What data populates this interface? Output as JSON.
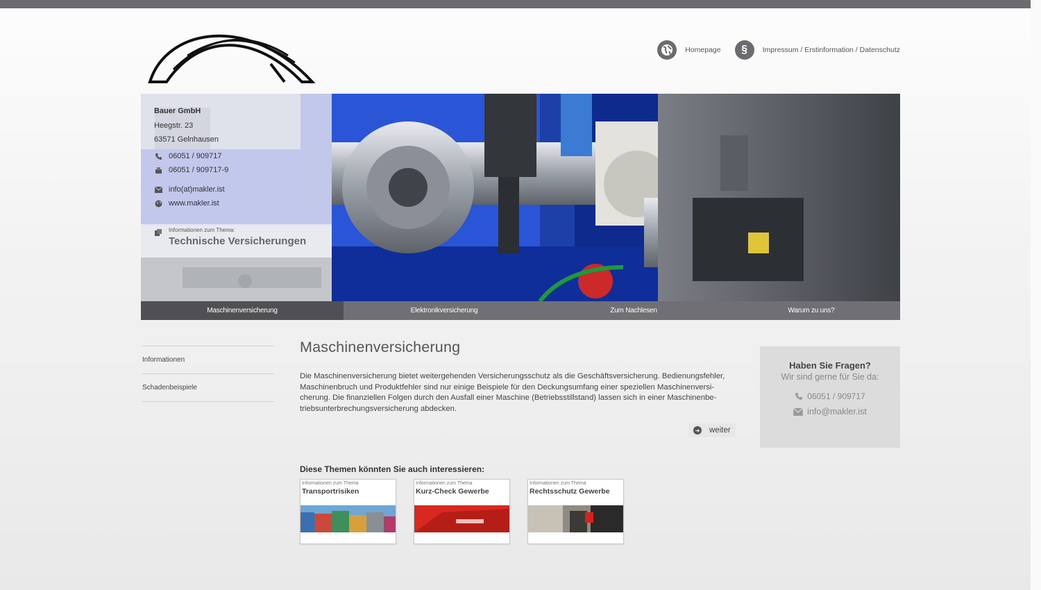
{
  "topnav": {
    "homepage_label": "Homepage",
    "impressum_label": "Impressum / Erstinformation / Datenschutz"
  },
  "address": {
    "company": "Bauer GmbH",
    "street": "Heegstr. 23",
    "city": "63571 Gelnhausen",
    "phone": "06051 / 909717",
    "fax": "06051 / 909717-9",
    "email": "info(at)makler.ist",
    "web": "www.makler.ist"
  },
  "topic": {
    "small": "Informationen zum Thema:",
    "big": "Technische Versicherungen"
  },
  "mainnav": {
    "tabs": [
      {
        "label": "Maschinenversicherung"
      },
      {
        "label": "Elektronikversicherung"
      },
      {
        "label": "Zum Nachlesen"
      },
      {
        "label": "Warum zu uns?"
      }
    ]
  },
  "sidenav": {
    "items": [
      {
        "label": "Informationen"
      },
      {
        "label": "Schadenbeispiele"
      }
    ]
  },
  "content": {
    "title": "Maschinenversicherung",
    "lines": [
      "Die Maschinenversicherung bietet weitergehenden Versicherungsschutz als die Geschäftsversicherung. Bedienungsfehler,",
      "Maschinenbruch und Produktfehler sind nur einige Beispiele für den Deckungsumfang einer speziellen Maschinenversi-",
      "cherung. Die finanziellen Folgen durch den Ausfall einer Maschine (Betriebsstillstand) lassen sich in einer Maschinenbe-",
      "triebsunterbrechungsversicherung abdecken."
    ],
    "weiter_label": "weiter"
  },
  "related": {
    "title": "Diese Themen könnten Sie auch interessieren:",
    "cards": [
      {
        "small": "Informationen zum Thema",
        "big": "Transportrisiken"
      },
      {
        "small": "Informationen zum Thema",
        "big": "Kurz-Check Gewerbe"
      },
      {
        "small": "Informationen zum Thema",
        "big": "Rechtsschutz Gewerbe"
      }
    ]
  },
  "questions": {
    "title": "Haben Sie Fragen?",
    "subtitle": "Wir sind gerne für Sie da:",
    "phone": "06051 / 909717",
    "email": "info@makler.ist"
  },
  "colors": {
    "nav_bg": "#6f6f74",
    "nav_active": "#4f4f54",
    "question_bg": "#dcdcdc"
  }
}
